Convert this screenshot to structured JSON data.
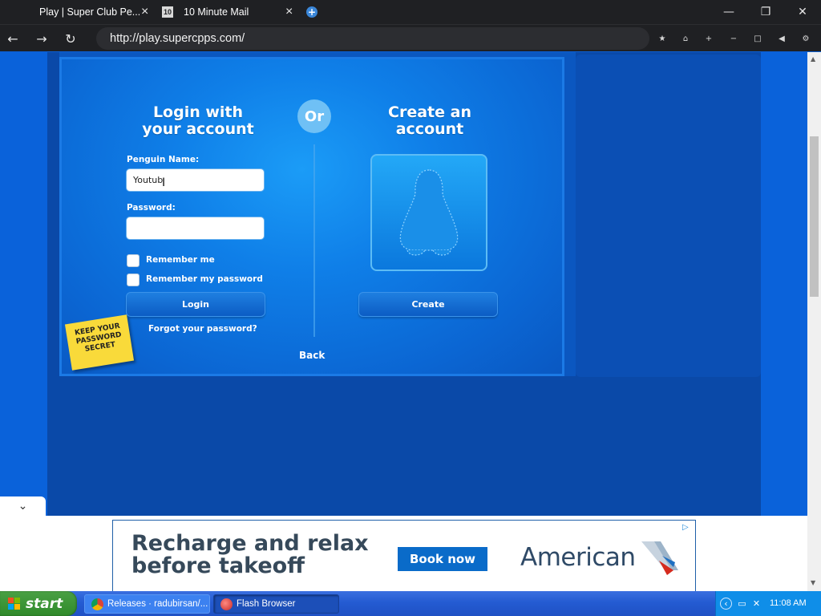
{
  "browser": {
    "tabs": [
      {
        "title": "Play | Super Club Pe...",
        "active": true
      },
      {
        "title": "10 Minute Mail",
        "favicon_text": "10",
        "active": false
      }
    ],
    "url": "http://play.supercpps.com/"
  },
  "login": {
    "heading_line1": "Login with",
    "heading_line2": "your account",
    "or_label": "Or",
    "penguin_name_label": "Penguin Name:",
    "penguin_name_value": "Youtub",
    "password_label": "Password:",
    "password_value": "",
    "remember_me_label": "Remember me",
    "remember_password_label": "Remember my password",
    "remember_me_checked": false,
    "remember_password_checked": false,
    "login_button": "Login",
    "forgot_link": "Forgot your password?",
    "back_link": "Back",
    "sticky_line1": "KEEP YOUR",
    "sticky_line2": "PASSWORD",
    "sticky_line3": "SECRET"
  },
  "create": {
    "heading_line1": "Create an",
    "heading_line2": "account",
    "create_button": "Create"
  },
  "ad": {
    "line1": "Recharge and relax",
    "line2": "before takeoff",
    "cta": "Book now",
    "brand": "American"
  },
  "taskbar": {
    "start_label": "start",
    "items": [
      {
        "label": "Releases · radubirsan/...",
        "icon": "chrome-icon"
      },
      {
        "label": "Flash Browser",
        "icon": "flash-browser-icon"
      }
    ],
    "clock": "11:08 AM"
  },
  "colors": {
    "page_bg": "#0a62da",
    "panel_accent": "#1b9cf7",
    "sticky": "#f9da3a",
    "ad_cta": "#0a6bc9"
  }
}
